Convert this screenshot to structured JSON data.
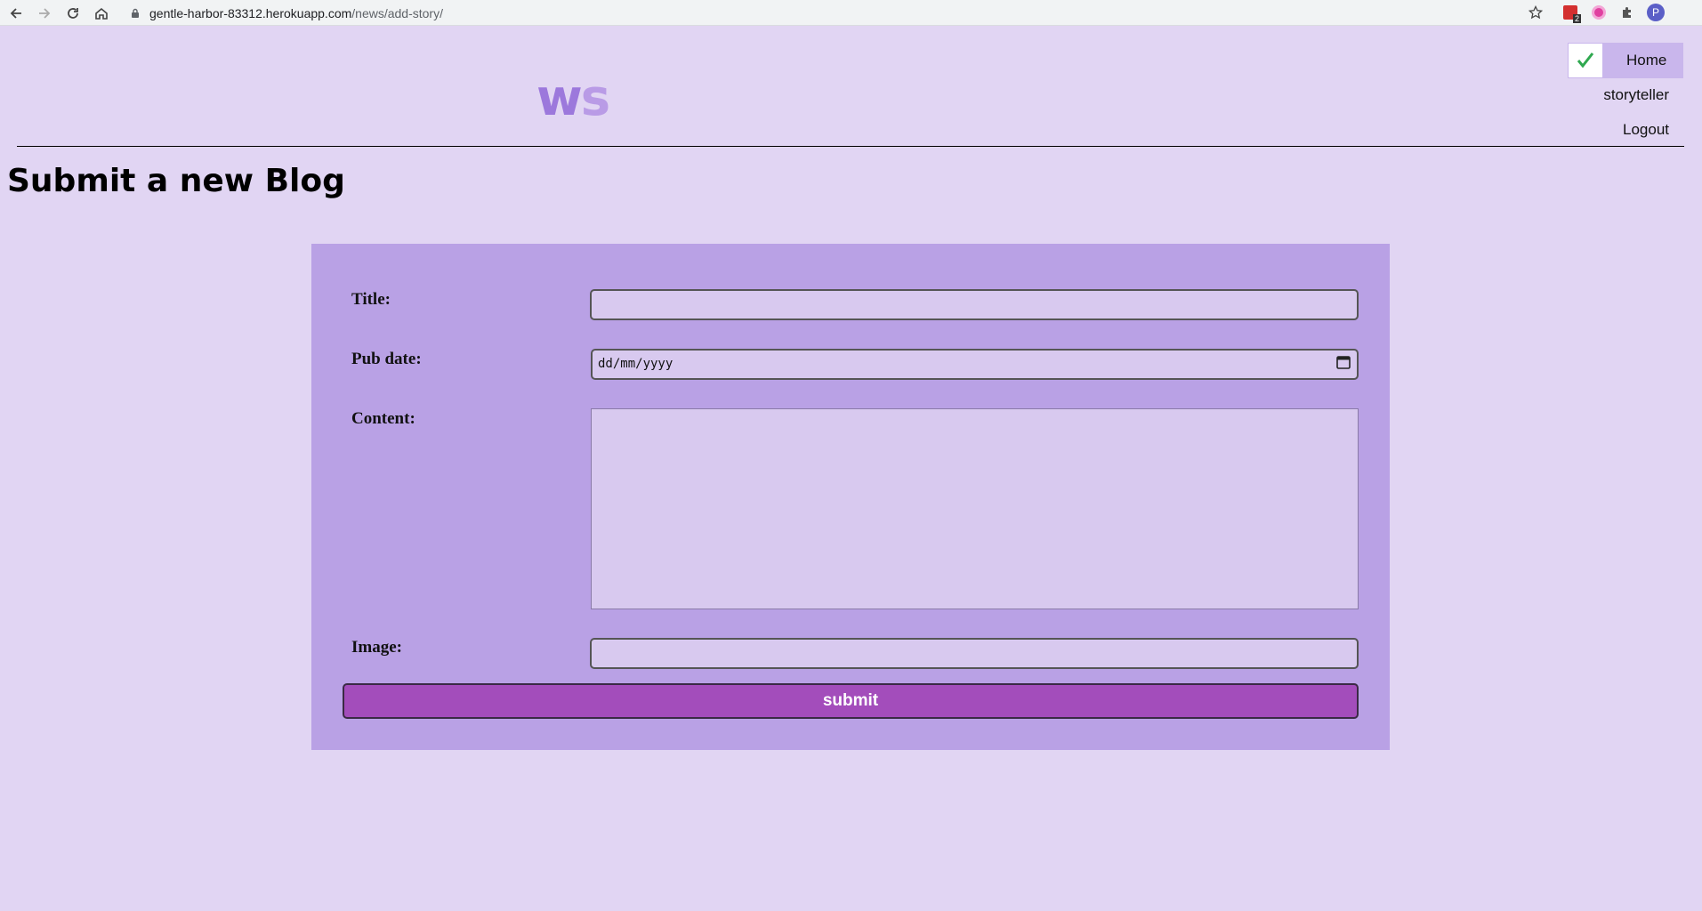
{
  "browser": {
    "url_host": "gentle-harbor-83312.herokuapp.com",
    "url_path": "/news/add-story/",
    "ext_badge": "2",
    "profile_initial": "P"
  },
  "site": {
    "logo_w": "w",
    "logo_s": "s",
    "nav": {
      "home": "Home",
      "user": "storyteller",
      "logout": "Logout"
    }
  },
  "page": {
    "title": "Submit a new Blog"
  },
  "form": {
    "title_label": "Title:",
    "title_value": "",
    "pubdate_label": "Pub date:",
    "pubdate_placeholder": "dd/mm/yyyy",
    "content_label": "Content:",
    "content_value": "",
    "image_label": "Image:",
    "image_value": "",
    "submit_label": "submit"
  },
  "colors": {
    "background": "#e1d5f3",
    "panel": "#b9a1e5",
    "input_bg": "#d8c9ef",
    "submit": "#a34dbb",
    "logo_w": "#9c78dc",
    "logo_s": "#b99be6",
    "check": "#2fa84f"
  }
}
